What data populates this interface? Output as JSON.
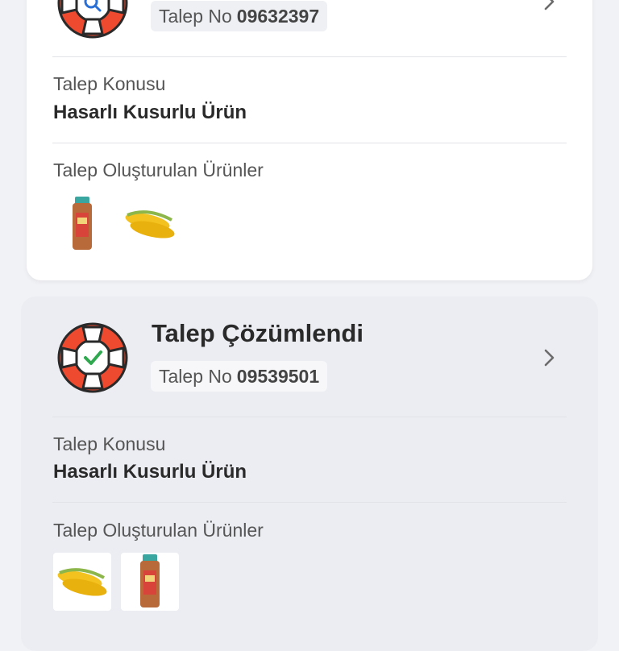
{
  "requests": [
    {
      "status_title": "",
      "request_no_label": "Talep No",
      "request_no": "09632397",
      "subject_label": "Talep Konusu",
      "subject": "Hasarlı Kusurlu Ürün",
      "products_label": "Talep Oluşturulan Ürünler",
      "status_icon": "lifebuoy-search-icon",
      "products": [
        "bread-icon",
        "corn-icon"
      ]
    },
    {
      "status_title": "Talep Çözümlendi",
      "request_no_label": "Talep No",
      "request_no": "09539501",
      "subject_label": "Talep Konusu",
      "subject": "Hasarlı Kusurlu Ürün",
      "products_label": "Talep Oluşturulan Ürünler",
      "status_icon": "lifebuoy-check-icon",
      "products": [
        "corn-icon",
        "bread-icon"
      ]
    }
  ],
  "colors": {
    "buoy_red": "#ee4a2f",
    "check_green": "#2fa84f",
    "chevron": "#6b6b6b"
  }
}
